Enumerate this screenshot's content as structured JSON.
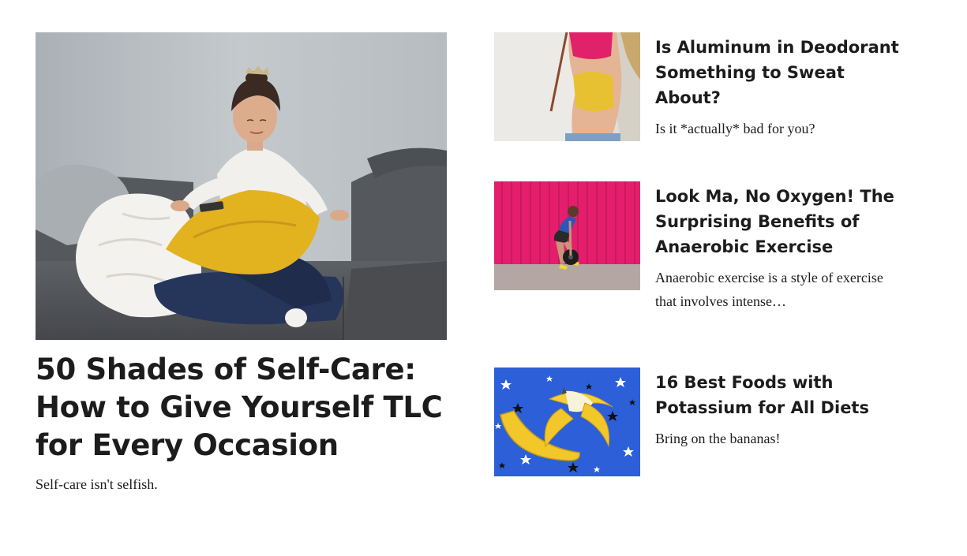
{
  "featured": {
    "title": "50 Shades of Self-Care: How to Give Yourself TLC for Every Occasion",
    "description": "Self-care isn't selfish.",
    "image": "woman-meditating-on-couch-with-pillow"
  },
  "articles": [
    {
      "title": "Is Aluminum in Deodorant Something to Sweat About?",
      "description": "Is it *actually* bad for you?",
      "image": "woman-yellow-sports-bra-arm-raised"
    },
    {
      "title": "Look Ma, No Oxygen! The Surprising Benefits of Anaerobic Exercise",
      "description": "Anaerobic exercise is a style of exercise that involves intense…",
      "image": "woman-lifting-barbell-pink-wall"
    },
    {
      "title": "16 Best Foods with Potassium for All Diets",
      "description": "Bring on the bananas!",
      "image": "banana-on-blue-star-background"
    }
  ],
  "colors": {
    "text": "#1c1c1c",
    "background": "#ffffff"
  }
}
